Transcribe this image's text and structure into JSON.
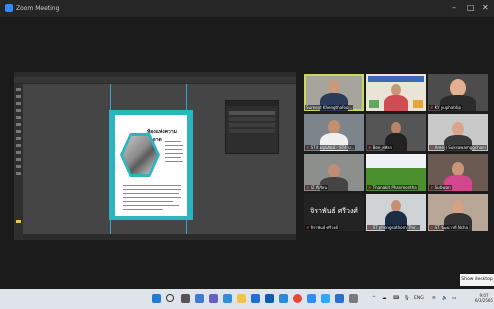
{
  "window": {
    "title": "Zoom Meeting",
    "controls": [
      "–",
      "□",
      "✕"
    ]
  },
  "shared_screen": {
    "app": "Adobe Photoshop",
    "poster_title": "ห้องแห่งความสะอาด",
    "panel_layers": [
      "Layer 1",
      "Background"
    ]
  },
  "participants": [
    {
      "name": "Sureeat Khengthafoo...",
      "muted": false,
      "active": true
    },
    {
      "name": "",
      "muted": false,
      "active": false
    },
    {
      "name": "KY yuphatdip",
      "muted": true,
      "active": false
    },
    {
      "name": "ST4 อรุณรัตน์ - ST4 ป...",
      "muted": true,
      "active": false
    },
    {
      "name": "Bee_ศศิธร",
      "muted": true,
      "active": false
    },
    {
      "name": "Aree(ุ) Suksawamggchani",
      "muted": true,
      "active": false
    },
    {
      "name": "IZ ที่เรียน",
      "muted": true,
      "active": false
    },
    {
      "name": "Thanakit Phanmontha",
      "muted": true,
      "active": false
    },
    {
      "name": "Sutiwan",
      "muted": true,
      "active": false
    },
    {
      "name": "จิราพันธ์ ศรีวงค์",
      "muted": true,
      "active": false,
      "big_text": "จิราพันธ์ ศรีวงศ์"
    },
    {
      "name": "ST phongsathorn Thir...",
      "muted": true,
      "active": false
    },
    {
      "name": "ST วัฒนาวดี Ncha",
      "muted": true,
      "active": false
    }
  ],
  "tooltip": "Show desktop",
  "taskbar": {
    "lang": "ENG",
    "time": "9:07",
    "date": "6/3/2565",
    "colors": {
      "bg": "#dfe3ea"
    }
  }
}
